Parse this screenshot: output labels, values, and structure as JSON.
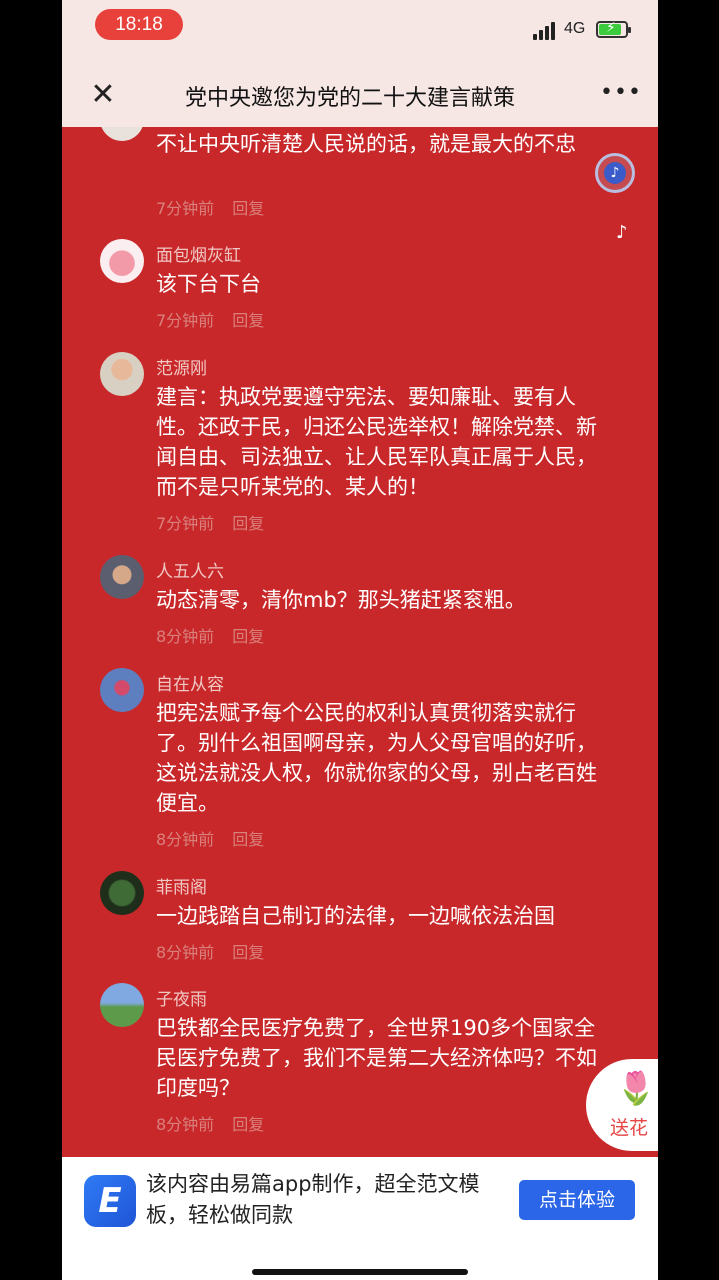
{
  "status_bar": {
    "time": "18:18",
    "network": "4G"
  },
  "nav": {
    "title": "党中央邀您为党的二十大建言献策"
  },
  "comments": [
    {
      "username": "",
      "text": "不让中央听清楚人民说的话，就是最大的不忠",
      "time": "7分钟前",
      "reply": "回复"
    },
    {
      "username": "面包烟灰缸",
      "text": "该下台下台",
      "time": "7分钟前",
      "reply": "回复"
    },
    {
      "username": "范源刚",
      "text": "建言：执政党要遵守宪法、要知廉耻、要有人性。还政于民，归还公民选举权！解除党禁、新闻自由、司法独立、让人民军队真正属于人民，而不是只听某党的、某人的！",
      "time": "7分钟前",
      "reply": "回复"
    },
    {
      "username": "人五人六",
      "text": "动态清零，清你mb？那头猪赶紧衮粗。",
      "time": "8分钟前",
      "reply": "回复"
    },
    {
      "username": "自在从容",
      "text": "把宪法赋予每个公民的权利认真贯彻落实就行了。别什么祖国啊母亲，为人父母官唱的好听，这说法就没人权，你就你家的父母，别占老百姓便宜。",
      "time": "8分钟前",
      "reply": "回复"
    },
    {
      "username": "菲雨阁",
      "text": "一边践踏自己制订的法律，一边喊依法治国",
      "time": "8分钟前",
      "reply": "回复"
    },
    {
      "username": "子夜雨",
      "text": "巴铁都全民医疗免费了，全世界190多个国家全民医疗免费了，我们不是第二大经济体吗？不如印度吗？",
      "time": "8分钟前",
      "reply": "回复"
    }
  ],
  "flower": {
    "label": "送花"
  },
  "promo": {
    "text": "该内容由易篇app制作，超全范文模板，轻松做同款",
    "button": "点击体验"
  }
}
